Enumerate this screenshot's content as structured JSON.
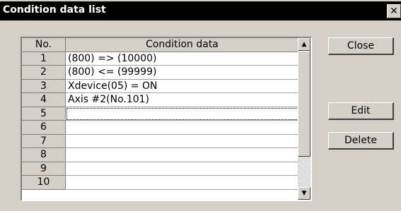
{
  "window": {
    "title": "Condition data list",
    "close_glyph": "✕"
  },
  "table": {
    "headers": {
      "no": "No.",
      "data": "Condition data"
    },
    "rows": [
      {
        "no": "1",
        "data": "(800) => (10000)"
      },
      {
        "no": "2",
        "data": "(800) <= (99999)"
      },
      {
        "no": "3",
        "data": "Xdevice(05) = ON"
      },
      {
        "no": "4",
        "data": "Axis #2(No.101)"
      },
      {
        "no": "5",
        "data": ""
      },
      {
        "no": "6",
        "data": ""
      },
      {
        "no": "7",
        "data": ""
      },
      {
        "no": "8",
        "data": ""
      },
      {
        "no": "9",
        "data": ""
      },
      {
        "no": "10",
        "data": ""
      }
    ],
    "selected_row": "5"
  },
  "scrollbar": {
    "up_glyph": "▲",
    "down_glyph": "▼"
  },
  "buttons": {
    "close": "Close",
    "edit": "Edit",
    "delete": "Delete"
  }
}
